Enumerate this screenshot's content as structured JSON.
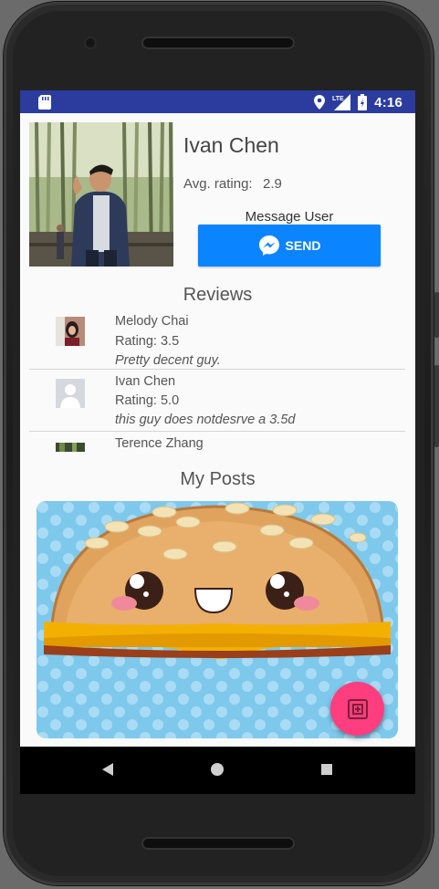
{
  "status_bar": {
    "time": "4:16",
    "network": "LTE",
    "icons": [
      "sd-card-icon",
      "location-icon",
      "signal-icon",
      "battery-icon"
    ]
  },
  "profile": {
    "name": "Ivan Chen",
    "avg_rating_label": "Avg. rating:",
    "avg_rating_value": "2.9",
    "message_label": "Message User",
    "send_label": "SEND"
  },
  "reviews": {
    "title": "Reviews",
    "items": [
      {
        "name": "Melody Chai",
        "rating": "Rating: 3.5",
        "text": "Pretty decent guy."
      },
      {
        "name": "Ivan Chen",
        "rating": "Rating: 5.0",
        "text": "this guy does notdesrve a 3.5d"
      },
      {
        "name": "Terence Zhang"
      }
    ]
  },
  "posts": {
    "title": "My Posts"
  },
  "colors": {
    "status_bar": "#2b3c9e",
    "send_button": "#0a84ff",
    "fab": "#ff3d7f"
  }
}
